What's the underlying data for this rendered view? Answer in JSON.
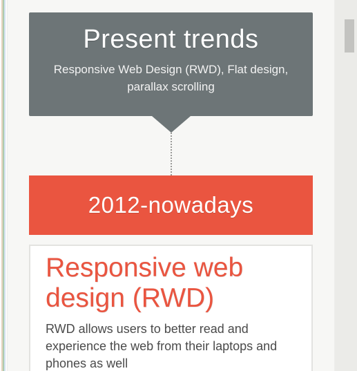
{
  "hero": {
    "title": "Present trends",
    "subtitle": "Responsive Web Design (RWD), Flat design, parallax scrolling"
  },
  "era": {
    "label": "2012-nowadays"
  },
  "card": {
    "heading": "Responsive web design (RWD)",
    "body": "RWD allows users to better read and experience the web from their laptops and phones as well"
  },
  "colors": {
    "hero_bg": "#6d7577",
    "accent": "#ea5540",
    "page_bg": "#f7f7f5"
  }
}
